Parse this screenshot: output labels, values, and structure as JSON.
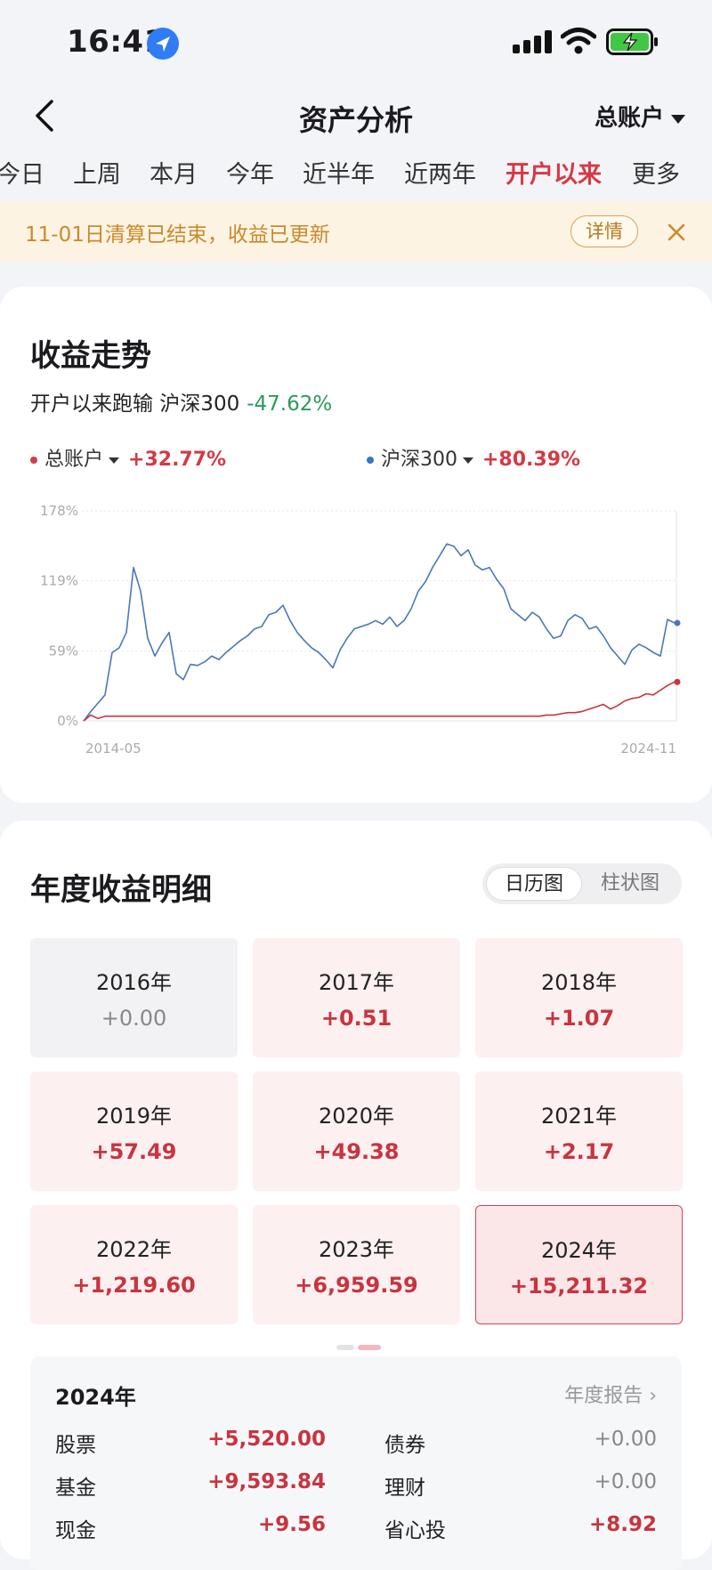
{
  "status": {
    "time": "16:41"
  },
  "nav": {
    "title": "资产分析",
    "account": "总账户"
  },
  "tabs": [
    "今日",
    "上周",
    "本月",
    "今年",
    "近半年",
    "近两年",
    "开户以来",
    "更多"
  ],
  "active_tab": "开户以来",
  "notice": {
    "text": "11-01日清算已结束，收益已更新",
    "button": "详情"
  },
  "trend": {
    "title": "收益走势",
    "subtitle": "开户以来跑输 沪深300",
    "subtitle_value": "-47.62%",
    "legend": [
      {
        "name": "总账户",
        "value": "+32.77%",
        "color": "#d43a45"
      },
      {
        "name": "沪深300",
        "value": "+80.39%",
        "color": "#3b73c4"
      }
    ]
  },
  "chart_data": {
    "type": "line",
    "yticks": [
      "178%",
      "119%",
      "59%",
      "0%"
    ],
    "ylim": [
      0,
      178
    ],
    "xlabels": [
      "2014-05",
      "2024-11"
    ],
    "grid": true,
    "series": [
      {
        "name": "沪深300",
        "color": "#4a78b5",
        "values": [
          0,
          8,
          15,
          22,
          58,
          62,
          75,
          130,
          110,
          70,
          55,
          66,
          75,
          40,
          35,
          48,
          47,
          50,
          55,
          52,
          58,
          63,
          68,
          72,
          78,
          80,
          90,
          92,
          98,
          85,
          75,
          68,
          62,
          58,
          52,
          45,
          60,
          70,
          78,
          80,
          82,
          85,
          82,
          88,
          80,
          85,
          95,
          110,
          118,
          130,
          140,
          150,
          148,
          140,
          145,
          132,
          128,
          130,
          120,
          112,
          95,
          90,
          85,
          92,
          88,
          78,
          70,
          72,
          85,
          90,
          87,
          78,
          80,
          72,
          62,
          55,
          48,
          60,
          65,
          62,
          58,
          55,
          86,
          83
        ],
        "last": 83
      },
      {
        "name": "总账户",
        "color": "#c8343f",
        "values": [
          0,
          5,
          2,
          4,
          4,
          4,
          4,
          4,
          4,
          4,
          4,
          4,
          4,
          4,
          4,
          4,
          4,
          4,
          4,
          4,
          4,
          4,
          4,
          4,
          4,
          4,
          4,
          4,
          4,
          4,
          4,
          4,
          4,
          4,
          4,
          4,
          4,
          4,
          4,
          4,
          4,
          4,
          4,
          4,
          4,
          4,
          4,
          4,
          4,
          4,
          4,
          4,
          4,
          4,
          4,
          4,
          4,
          4,
          4,
          4,
          4,
          4,
          4,
          4,
          4,
          5,
          5,
          6,
          7,
          7,
          8,
          10,
          12,
          14,
          10,
          13,
          17,
          19,
          20,
          23,
          22,
          26,
          30,
          33
        ],
        "last": 33
      }
    ]
  },
  "yearly": {
    "title": "年度收益明细",
    "toggle": [
      "日历图",
      "柱状图"
    ],
    "years": [
      {
        "year": "2016年",
        "amount": "+0.00"
      },
      {
        "year": "2017年",
        "amount": "+0.51"
      },
      {
        "year": "2018年",
        "amount": "+1.07"
      },
      {
        "year": "2019年",
        "amount": "+57.49"
      },
      {
        "year": "2020年",
        "amount": "+49.38"
      },
      {
        "year": "2021年",
        "amount": "+2.17"
      },
      {
        "year": "2022年",
        "amount": "+1,219.60"
      },
      {
        "year": "2023年",
        "amount": "+6,959.59"
      },
      {
        "year": "2024年",
        "amount": "+15,211.32"
      }
    ],
    "selected_year": "2024年"
  },
  "detail": {
    "year": "2024年",
    "report": "年度报告 ›",
    "rows": [
      {
        "left_name": "股票",
        "left_value": "+5,520.00",
        "right_name": "债券",
        "right_value": "+0.00"
      },
      {
        "left_name": "基金",
        "left_value": "+9,593.84",
        "right_name": "理财",
        "right_value": "+0.00"
      },
      {
        "left_name": "现金",
        "left_value": "+9.56",
        "right_name": "省心投",
        "right_value": "+8.92"
      }
    ]
  }
}
